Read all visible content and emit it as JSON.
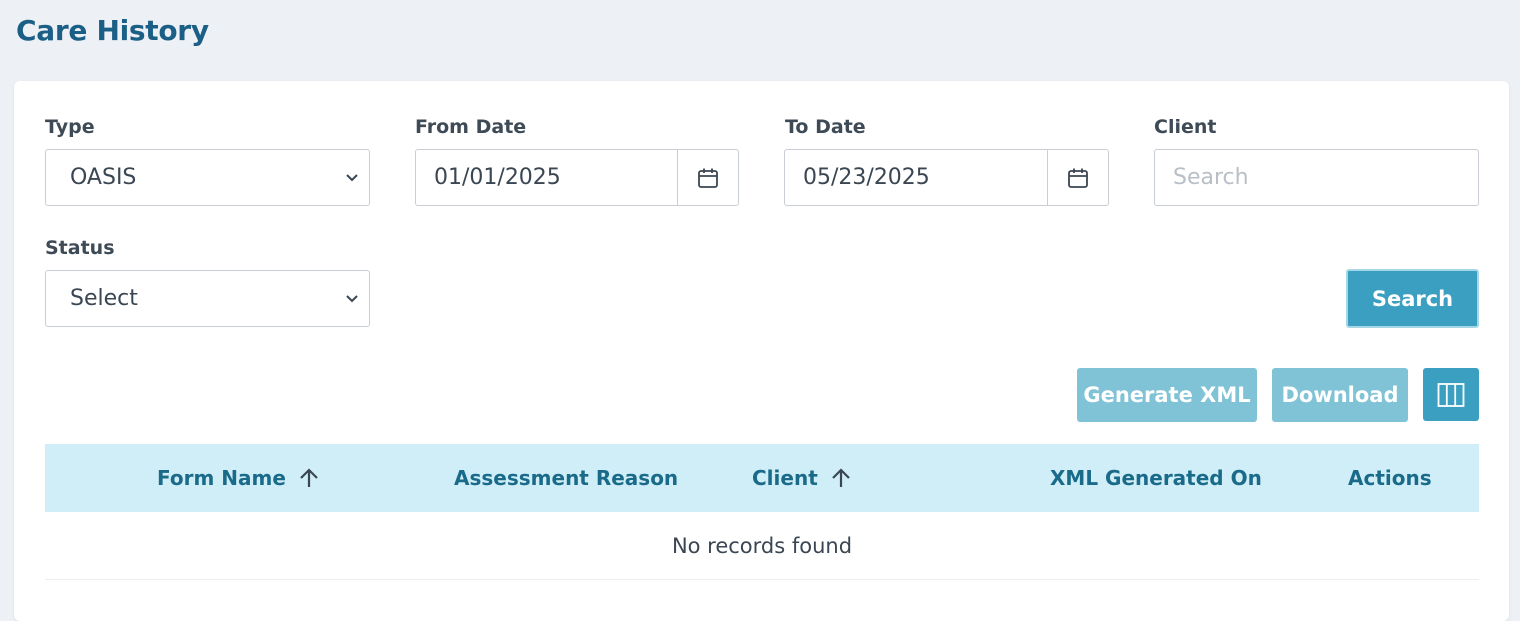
{
  "page": {
    "title": "Care History"
  },
  "filters": {
    "type": {
      "label": "Type",
      "value": "OASIS"
    },
    "from_date": {
      "label": "From Date",
      "value": "01/01/2025"
    },
    "to_date": {
      "label": "To Date",
      "value": "05/23/2025"
    },
    "client": {
      "label": "Client",
      "placeholder": "Search"
    },
    "status": {
      "label": "Status",
      "value": "Select"
    },
    "search_button": "Search"
  },
  "toolbar": {
    "generate_xml": "Generate XML",
    "download": "Download",
    "columns_icon": "columns-icon"
  },
  "table": {
    "columns": [
      "Form Name",
      "Assessment Reason",
      "Client",
      "XML Generated On",
      "Actions"
    ],
    "empty_message": "No records found"
  },
  "colors": {
    "title": "#1b5f86",
    "primary": "#3a9fc0",
    "disabled": "#80c3d6",
    "header_bg": "#cfeef7",
    "header_text": "#1a6a8a",
    "background": "#edf0f4"
  }
}
